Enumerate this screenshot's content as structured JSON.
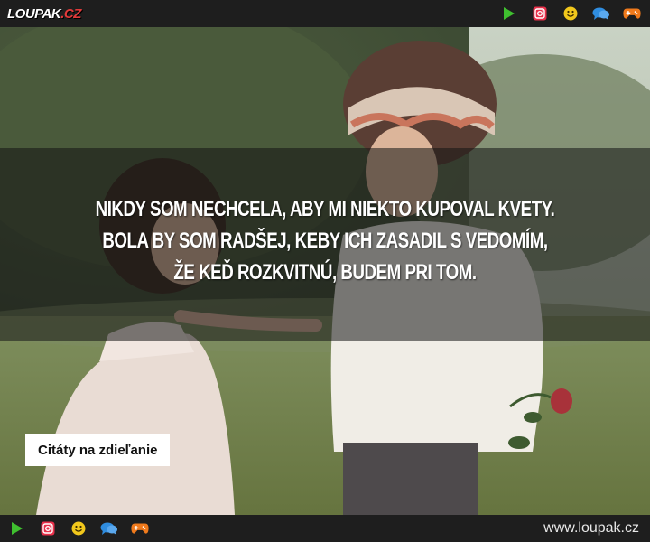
{
  "header": {
    "logo_main": "LOUPAK",
    "logo_tld": ".CZ",
    "icons": [
      "play-icon",
      "instagram-icon",
      "smiley-icon",
      "chat-icon",
      "gamepad-icon"
    ]
  },
  "quote": {
    "lines": [
      "NIKDY SOM NECHCELA, ABY MI NIEKTO KUPOVAL KVETY.",
      "BOLA BY SOM RADŠEJ, KEBY ICH ZASADIL S VEDOMÍM,",
      "ŽE KEĎ ROZKVITNÚ, BUDEM PRI TOM."
    ]
  },
  "tag": {
    "label": "Citáty na zdieľanie"
  },
  "footer": {
    "site": "www.loupak.cz",
    "icons": [
      "play-icon",
      "instagram-icon",
      "smiley-icon",
      "chat-icon",
      "gamepad-icon"
    ]
  },
  "colors": {
    "play": "#3fbf2f",
    "instagram": "#e8304a",
    "smiley": "#f2c81c",
    "chat": "#2f8de0",
    "gamepad": "#f07a1c",
    "logo_accent": "#e23a3a"
  }
}
